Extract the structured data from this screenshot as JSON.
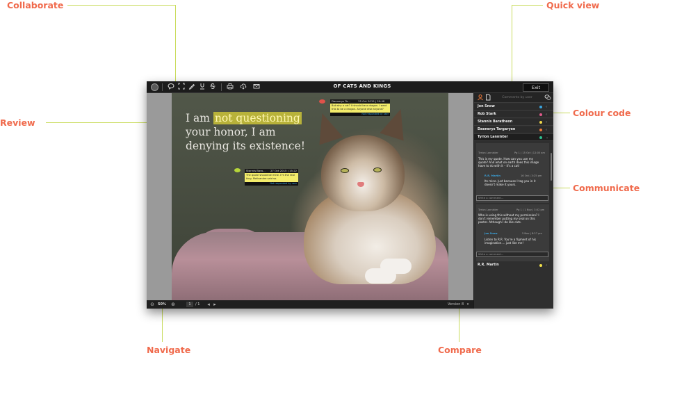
{
  "callouts": {
    "collaborate": "Collaborate",
    "quick_view": "Quick view",
    "review": "Review",
    "colour_code": "Colour code",
    "communicate": "Communicate",
    "navigate": "Navigate",
    "compare": "Compare"
  },
  "toolbar": {
    "title": "OF CATS AND KINGS",
    "exit_label": "Exit",
    "tools": [
      "comment-icon",
      "select-area-icon",
      "pen-icon",
      "underline-icon",
      "strikethrough-icon",
      "print-icon",
      "download-icon",
      "mail-icon"
    ]
  },
  "document": {
    "quote_before": "I am",
    "quote_highlight": "not questioning",
    "quote_after": "your honor, I am denying its existence!",
    "note1": {
      "author": "Daenerys Ta...",
      "date": "25 Oct 2015 | 20:48",
      "text": "But why a cat? It should be a dragon. I want this to be a dragon. Anyone else anyone?",
      "foot": "Not responded by user",
      "color": "#e0524a"
    },
    "note2": {
      "author": "Stannis Bara...",
      "date": "27 Oct 2015 | 15:22",
      "text": "The quote should be mine. I'm the real king. Melisandre said so.",
      "foot": "Not responded by user",
      "color": "#b6d53a"
    }
  },
  "bottom": {
    "zoom": "50%",
    "page_current": "1",
    "page_total": "/ 1",
    "version": "Version 8"
  },
  "panel": {
    "search_placeholder": "Comments by user",
    "users": [
      {
        "name": "Jon Snow",
        "color": "#3aa6e0"
      },
      {
        "name": "Rob Stark",
        "color": "#e05a8a"
      },
      {
        "name": "Stannis Baratheon",
        "color": "#f0d84a"
      },
      {
        "name": "Daenerys Targaryen",
        "color": "#f07a3a"
      },
      {
        "name": "Tyrion Lannister",
        "color": "#2fbf8f"
      }
    ],
    "thread1": {
      "meta_author": "Tyrion Lannister",
      "meta_date": "Pg 1 | 15 Oct | 12:05 am",
      "text": "This is my quote. How can you use my quote? And what on earth does this image have to do with it – it's a cat!",
      "reply_author": "R.R. Martin",
      "reply_date": "16 Oct | 3:25 pm",
      "reply_text": "Its mine. Just because I tag you in it doesn't make it yours.",
      "write": "Write a comment..."
    },
    "thread2": {
      "meta_author": "Tyrion Lannister",
      "meta_date": "Pg 1 | 1 Nov | 3:02 pm",
      "text": "Who is using this without my permission? I don't remember putting my seal on this poster. Although I do like cats.",
      "reply_author": "Jon Snow",
      "reply_date": "5 Nov | 8:27 pm",
      "reply_text": "Listen to R.R. You're a figment of his imagination.... just like me!",
      "write": "Write a comment..."
    },
    "last_user": {
      "name": "R.R. Martin",
      "color": "#f0e04a"
    }
  }
}
